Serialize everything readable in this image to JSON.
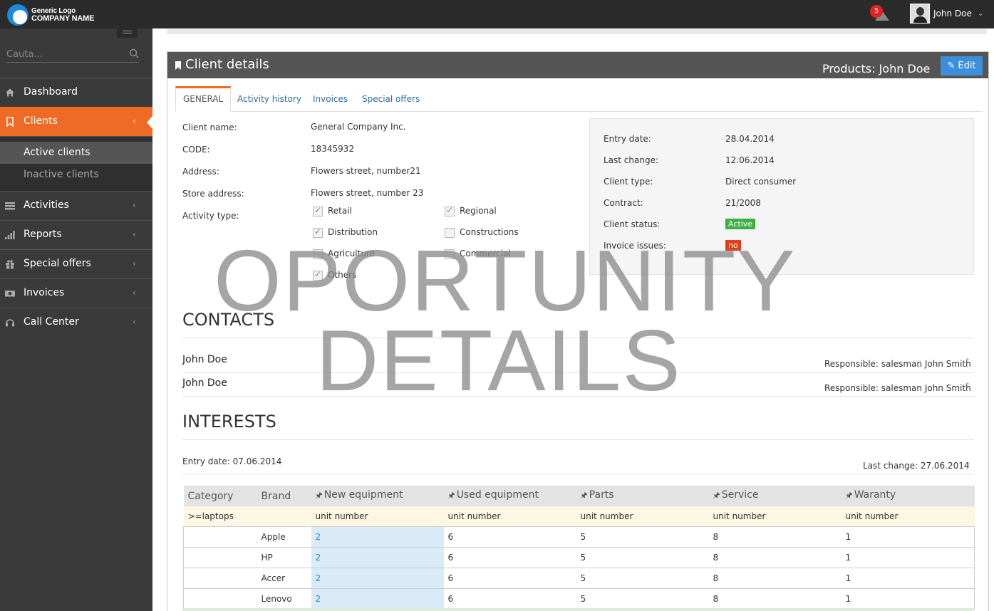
{
  "header": {
    "logo_line1": "Generic Logo",
    "logo_line2": "COMPANY NAME",
    "notification_count": "5",
    "user_name": "John Doe"
  },
  "sidebar": {
    "search_placeholder": "Cauta...",
    "items": [
      {
        "label": "Dashboard",
        "icon": "home-icon"
      },
      {
        "label": "Clients",
        "icon": "bookmark-icon"
      },
      {
        "label": "Activities",
        "icon": "list-icon"
      },
      {
        "label": "Reports",
        "icon": "bar-chart-icon"
      },
      {
        "label": "Special offers",
        "icon": "gift-icon"
      },
      {
        "label": "Invoices",
        "icon": "money-icon"
      },
      {
        "label": "Call Center",
        "icon": "headset-icon"
      }
    ],
    "subitems": [
      "Active clients",
      "Inactive clients"
    ]
  },
  "panel": {
    "title": "Client details",
    "products_label": "Products: John Doe",
    "edit_label": "Edit"
  },
  "tabs": [
    "GENERAL",
    "Activity history",
    "Invoices",
    "Special offers"
  ],
  "client": {
    "name_label": "Client name:",
    "name": "General Company Inc.",
    "code_label": "CODE:",
    "code": "18345932",
    "address_label": "Address:",
    "address": "Flowers street, number21",
    "store_label": "Store address:",
    "store": "Flowers street, number 23",
    "activity_label": "Activity type:",
    "activity_types": [
      {
        "label": "Retail",
        "checked": true
      },
      {
        "label": "Regional",
        "checked": true
      },
      {
        "label": "Distribution",
        "checked": true
      },
      {
        "label": "Constructions",
        "checked": false
      },
      {
        "label": "Agriculture",
        "checked": false
      },
      {
        "label": "Commercial",
        "checked": false
      },
      {
        "label": "Others",
        "checked": true
      }
    ]
  },
  "info": {
    "entry_label": "Entry date:",
    "entry": "28.04.2014",
    "change_label": "Last change:",
    "change": "12.06.2014",
    "type_label": "Client type:",
    "type": "Direct consumer",
    "contract_label": "Contract:",
    "contract": "21/2008",
    "status_label": "Client status:",
    "status": "Active",
    "issues_label": "Invoice issues:",
    "issues": "no",
    "status_color": "#3cb043",
    "issues_color": "#e0401f"
  },
  "contacts": {
    "title": "CONTACTS",
    "items": [
      {
        "name": "John Doe",
        "responsible": "Responsible: salesman John Smith"
      },
      {
        "name": "John Doe",
        "responsible": "Responsible: salesman John Smith"
      }
    ]
  },
  "interests": {
    "title": "INTERESTS",
    "entry": "Entry date: 07.06.2014",
    "last_change": "Last change: 27.06.2014",
    "columns": [
      "Category",
      "Brand",
      "New equipment",
      "Used equipment",
      "Parts",
      "Service",
      "Waranty"
    ],
    "subheader": [
      ">=laptops",
      "",
      "unit number",
      "unit number",
      "unit number",
      "unit number",
      "unit number"
    ],
    "rows": [
      [
        "",
        "Apple",
        "2",
        "6",
        "5",
        "8",
        "1"
      ],
      [
        "",
        "HP",
        "2",
        "6",
        "5",
        "8",
        "1"
      ],
      [
        "",
        "Accer",
        "2",
        "6",
        "5",
        "8",
        "1"
      ],
      [
        "",
        "Lenovo",
        "2",
        "6",
        "5",
        "8",
        "1"
      ]
    ]
  },
  "watermark": {
    "line1": "OPORTUNITY",
    "line2": "DETAILS"
  },
  "colors": {
    "accent": "#ef6a24",
    "primary": "#3b8fdd",
    "sidebar": "#3a3a3a"
  }
}
